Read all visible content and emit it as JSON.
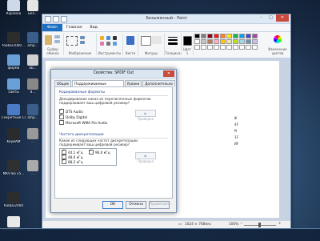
{
  "desktop": {
    "icons": [
      {
        "label": "Корзина",
        "color": "#cfd8e6"
      },
      {
        "label": "foobar2000...",
        "color": "#2d2d2d"
      },
      {
        "label": "фирма",
        "color": "#6aa0d8"
      },
      {
        "label": "сайты",
        "color": "#6aa0d8"
      },
      {
        "label": "Секретные Сложенос...",
        "color": "#4b7bc4"
      },
      {
        "label": "KeyBAM",
        "color": "#2b2b2b"
      },
      {
        "label": "MKVToo v5...",
        "color": "#303030"
      },
      {
        "label": "foobar2000",
        "color": "#2d2d2d"
      },
      {
        "label": "Безымянный",
        "color": "#e8e8e8"
      }
    ],
    "icons_col2": [
      {
        "label": "Без...",
        "color": "#e6e6e6"
      },
      {
        "label": "amp...",
        "color": "#3b5d8a"
      },
      {
        "label": "ab...",
        "color": "#d0d0d0"
      },
      {
        "label": "d...",
        "color": "#888888"
      },
      {
        "label": "amp...",
        "color": "#3b5d8a"
      },
      {
        "label": "...",
        "color": "#999999"
      },
      {
        "label": "...",
        "color": "#aaaaaa"
      }
    ]
  },
  "paint": {
    "title": "Безымянный - Paint",
    "menu": {
      "file": "Файл",
      "tabs": [
        "Главная",
        "Вид"
      ]
    },
    "ribbon": {
      "groups": [
        "Буфер обмена",
        "Изображение",
        "Инструменты",
        "Кисти",
        "Фигуры",
        "Толщина",
        "Цвет 1",
        "Цвет 2",
        "Цвета",
        "Изменение цветов"
      ]
    },
    "palette": [
      "#000000",
      "#7f7f7f",
      "#880015",
      "#ed1c24",
      "#ff7f27",
      "#fff200",
      "#22b14c",
      "#00a2e8",
      "#3f48cc",
      "#a349a4",
      "#ffffff",
      "#c3c3c3",
      "#b97a57",
      "#ffaec9",
      "#ffc90e",
      "#efe4b0",
      "#b5e61d",
      "#99d9ea",
      "#7092be",
      "#c8bfe7",
      "#ffffff",
      "#ffffff",
      "#ffffff",
      "#ffffff",
      "#ffffff",
      "#ffffff",
      "#ffffff",
      "#ffffff",
      "#ffffff",
      "#ffffff"
    ],
    "color1": "#000000",
    "color2": "#ffffff",
    "canvas_text": [
      "Ш",
      "4F",
      "M",
      "1F",
      "ИF"
    ],
    "status": {
      "size": "1024 × 768пкс",
      "zoom": "100%"
    }
  },
  "dialog": {
    "title": "Свойства: SPDIF Out",
    "close": "✕",
    "tabs": [
      "Общие",
      "Поддерживаемые форматы",
      "Уровни",
      "Дополнительно"
    ],
    "active_tab": 1,
    "section1": {
      "title": "Кодированные форматы",
      "description": "Декодирование каких из перечисленных форматов поддерживает ваш цифровой ресивер?",
      "items": [
        {
          "label": "DTS Audio",
          "checked": true
        },
        {
          "label": "Dolby Digital",
          "checked": true
        },
        {
          "label": "Microsoft WMA Pro Audio",
          "checked": false
        }
      ],
      "test": "Проверка"
    },
    "section2": {
      "title": "Частота дискретизации",
      "description": "Какие из следующих частот дискретизации поддерживает ваш цифровой ресивер?",
      "rates": [
        {
          "label": "44,1 кГц",
          "checked": true
        },
        {
          "label": "48,0 кГц",
          "checked": true
        },
        {
          "label": "88,2 кГц",
          "checked": true
        },
        {
          "label": "96,0 кГц",
          "checked": true
        }
      ],
      "test": "Проверка"
    },
    "buttons": {
      "ok": "ОК",
      "cancel": "Отмена",
      "apply": "Применить"
    }
  }
}
